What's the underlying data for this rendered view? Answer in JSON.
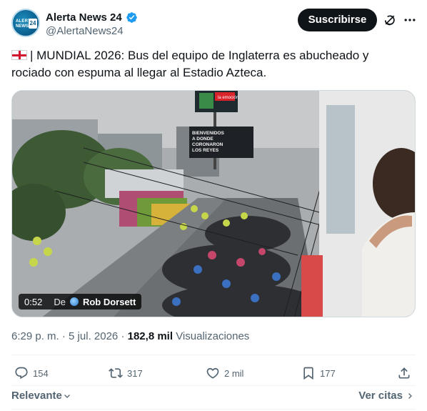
{
  "author": {
    "name": "Alerta News 24",
    "handle": "@AlertaNews24",
    "avatar_text": [
      "ALERTA",
      "NEWS",
      "24"
    ]
  },
  "header": {
    "subscribe_label": "Suscribirse",
    "icons": [
      "verified-badge-icon",
      "grok-icon",
      "more-options-icon"
    ]
  },
  "tweet": {
    "flag_icon": "england-flag",
    "text": "| MUNDIAL 2026: Bus del equipo de Inglaterra es abucheado y rociado con espuma al llegar al Estadio Azteca."
  },
  "media": {
    "duration": "0:52",
    "credit_prefix": "De",
    "credit_author": "Rob Dorsett",
    "billboard_text": [
      "BIENVENIDOS",
      "A DONDE",
      "CORONARON",
      "LOS REYES"
    ],
    "sign_text": "la emoción"
  },
  "meta": {
    "time": "6:29 p. m.",
    "separator": "·",
    "date": "5 jul. 2026",
    "views_count": "182,8 mil",
    "views_label": "Visualizaciones"
  },
  "actions": {
    "replies": "154",
    "reposts": "317",
    "likes": "2 mil",
    "bookmarks": "177"
  },
  "footer": {
    "sort_label": "Relevante",
    "quotes_label": "Ver citas"
  },
  "colors": {
    "text": "#0f1419",
    "muted": "#536471",
    "verified": "#1d9bf0",
    "button_bg": "#0f1419"
  }
}
